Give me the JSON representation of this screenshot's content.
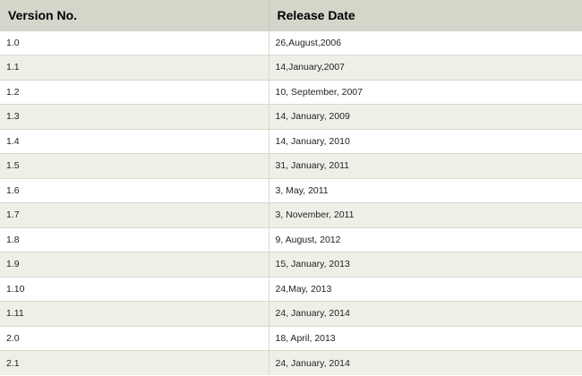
{
  "table": {
    "headers": [
      "Version No.",
      "Release Date"
    ],
    "rows": [
      [
        "1.0",
        "26,August,2006"
      ],
      [
        "1.1",
        "14,January,2007"
      ],
      [
        "1.2",
        "10, September, 2007"
      ],
      [
        "1.3",
        "14, January, 2009"
      ],
      [
        "1.4",
        "14, January, 2010"
      ],
      [
        "1.5",
        "31, January, 2011"
      ],
      [
        "1.6",
        "3, May, 2011"
      ],
      [
        "1.7",
        "3, November, 2011"
      ],
      [
        "1.8",
        "9, August, 2012"
      ],
      [
        "1.9",
        "15, January, 2013"
      ],
      [
        "1.10",
        "24,May, 2013"
      ],
      [
        "1.11",
        "24, January, 2014"
      ],
      [
        "2.0",
        "18, April, 2013"
      ],
      [
        "2.1",
        "24, January, 2014"
      ]
    ]
  },
  "colors": {
    "header_background": "#d3d6c9",
    "row_alt_background": "#eef0e8",
    "row_background": "#ffffff"
  }
}
